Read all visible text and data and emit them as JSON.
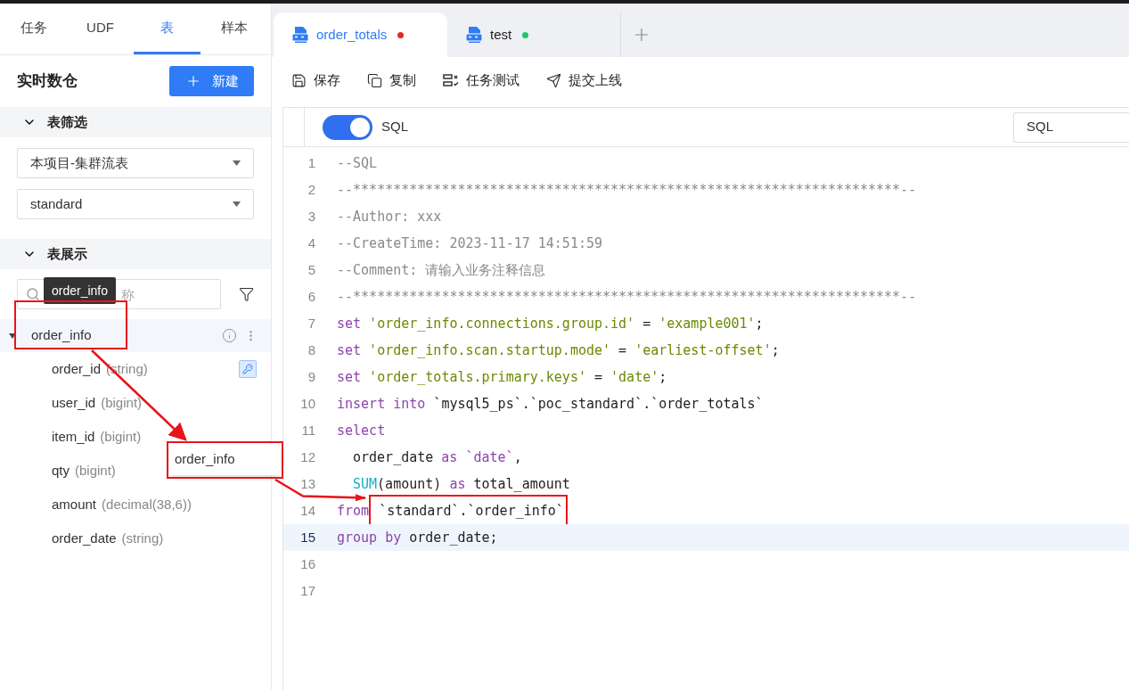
{
  "sidebar": {
    "tabs": [
      {
        "label": "任务",
        "selected": false
      },
      {
        "label": "UDF",
        "selected": false
      },
      {
        "label": "表",
        "selected": true
      },
      {
        "label": "样本",
        "selected": false
      }
    ],
    "title": "实时数仓",
    "new_button": "新建",
    "filter_section": {
      "title": "表筛选",
      "expanded": true,
      "selects": [
        "本项目-集群流表",
        "standard"
      ]
    },
    "display_section": {
      "title": "表展示",
      "expanded": true,
      "search_placeholder": "称",
      "tree": [
        {
          "name": "order_info",
          "expanded": true,
          "selected": true,
          "children": [
            {
              "name": "order_id",
              "type": "(string)",
              "key": true
            },
            {
              "name": "user_id",
              "type": "(bigint)",
              "key": false
            },
            {
              "name": "item_id",
              "type": "(bigint)",
              "key": false
            },
            {
              "name": "qty",
              "type": "(bigint)",
              "key": false
            },
            {
              "name": "amount",
              "type": "(decimal(38,6))",
              "key": false
            },
            {
              "name": "order_date",
              "type": "(string)",
              "key": false
            }
          ]
        }
      ]
    }
  },
  "tooltip": "order_info",
  "drag_ghost": "order_info",
  "editor_tabs": [
    {
      "label": "order_totals",
      "selected": true,
      "color": "#e5262b"
    },
    {
      "label": "test",
      "selected": false,
      "color": "#1ec76a"
    }
  ],
  "toolbar": [
    {
      "kind": "save",
      "label": "保存"
    },
    {
      "kind": "copy",
      "label": "复制"
    },
    {
      "kind": "test",
      "label": "任务测试"
    },
    {
      "kind": "submit",
      "label": "提交上线"
    }
  ],
  "editor": {
    "toggle": {
      "on": true,
      "label": "SQL"
    },
    "language": "SQL",
    "lines": [
      {
        "n": "1",
        "current": false,
        "indent": false,
        "tokens": [
          {
            "kind": "comment",
            "text": "--SQL"
          }
        ]
      },
      {
        "n": "2",
        "current": false,
        "indent": false,
        "tokens": [
          {
            "kind": "comment",
            "text": "--********************************************************************--"
          }
        ]
      },
      {
        "n": "3",
        "current": false,
        "indent": false,
        "tokens": [
          {
            "kind": "comment",
            "text": "--Author: xxx"
          }
        ]
      },
      {
        "n": "4",
        "current": false,
        "indent": false,
        "tokens": [
          {
            "kind": "comment",
            "text": "--CreateTime: 2023-11-17 14:51:59"
          }
        ]
      },
      {
        "n": "5",
        "current": false,
        "indent": false,
        "tokens": [
          {
            "kind": "comment",
            "text": "--Comment: 请输入业务注释信息"
          }
        ]
      },
      {
        "n": "6",
        "current": false,
        "indent": false,
        "tokens": [
          {
            "kind": "comment",
            "text": "--********************************************************************--"
          }
        ]
      },
      {
        "n": "7",
        "current": false,
        "indent": false,
        "tokens": [
          {
            "kind": "keyword",
            "text": "set"
          },
          {
            "kind": "string",
            "text": " 'order_info.connections.group.id'"
          },
          {
            "kind": "plain",
            "text": " = "
          },
          {
            "kind": "string",
            "text": "'example001'"
          },
          {
            "kind": "plain",
            "text": ";"
          }
        ]
      },
      {
        "n": "8",
        "current": false,
        "indent": false,
        "tokens": [
          {
            "kind": "keyword",
            "text": "set"
          },
          {
            "kind": "string",
            "text": " 'order_info.scan.startup.mode'"
          },
          {
            "kind": "plain",
            "text": " = "
          },
          {
            "kind": "string",
            "text": "'earliest-offset'"
          },
          {
            "kind": "plain",
            "text": ";"
          }
        ]
      },
      {
        "n": "9",
        "current": false,
        "indent": false,
        "tokens": [
          {
            "kind": "keyword",
            "text": "set"
          },
          {
            "kind": "string",
            "text": " 'order_totals.primary.keys'"
          },
          {
            "kind": "plain",
            "text": " = "
          },
          {
            "kind": "string",
            "text": "'date'"
          },
          {
            "kind": "plain",
            "text": ";"
          }
        ]
      },
      {
        "n": "10",
        "current": false,
        "indent": false,
        "tokens": [
          {
            "kind": "keyword",
            "text": "insert into"
          },
          {
            "kind": "plain",
            "text": " `mysql5_ps`.`poc_standard`.`order_totals`"
          }
        ]
      },
      {
        "n": "11",
        "current": false,
        "indent": false,
        "tokens": [
          {
            "kind": "keyword",
            "text": "select"
          }
        ]
      },
      {
        "n": "12",
        "current": false,
        "indent": true,
        "tokens": [
          {
            "kind": "plain",
            "text": "order_date "
          },
          {
            "kind": "keyword",
            "text": "as `date`"
          },
          {
            "kind": "plain",
            "text": ","
          }
        ]
      },
      {
        "n": "13",
        "current": false,
        "indent": true,
        "tokens": [
          {
            "kind": "function",
            "text": "SUM"
          },
          {
            "kind": "plain",
            "text": "(amount) "
          },
          {
            "kind": "keyword",
            "text": "as"
          },
          {
            "kind": "plain",
            "text": " total_amount"
          }
        ]
      },
      {
        "n": "14",
        "current": false,
        "indent": false,
        "tokens": [
          {
            "kind": "keyword",
            "text": "from"
          },
          {
            "kind": "boxed",
            "text": " `standard`.`order_info`"
          }
        ]
      },
      {
        "n": "15",
        "current": true,
        "indent": false,
        "tokens": [
          {
            "kind": "keyword",
            "text": "group by"
          },
          {
            "kind": "plain",
            "text": " order_date;"
          }
        ]
      },
      {
        "n": "16",
        "current": false
      },
      {
        "n": "17",
        "current": false
      }
    ]
  }
}
